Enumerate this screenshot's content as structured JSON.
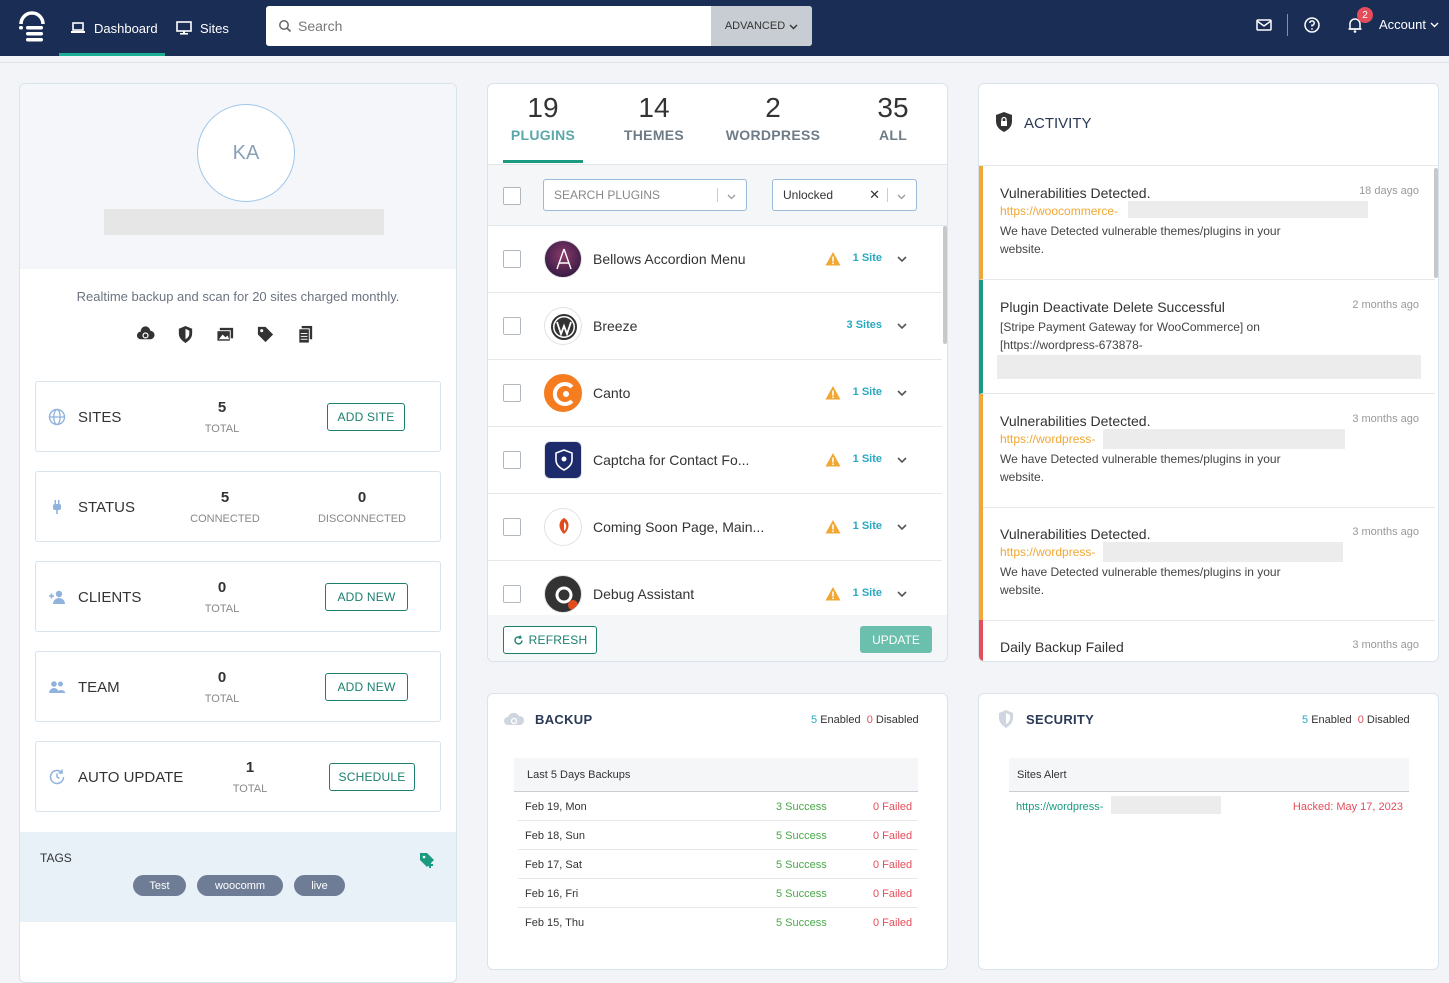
{
  "nav": {
    "tabs": [
      {
        "label": "Dashboard"
      },
      {
        "label": "Sites"
      }
    ],
    "search_placeholder": "Search",
    "advanced": "ADVANCED",
    "notifications": "2",
    "account": "Account"
  },
  "profile": {
    "initials": "KA",
    "plan": "Realtime backup and scan for 20 sites charged monthly."
  },
  "stats": {
    "sites": {
      "label": "SITES",
      "value": "5",
      "sub": "TOTAL",
      "action": "ADD SITE"
    },
    "status": {
      "label": "STATUS",
      "connected": "5",
      "connected_label": "CONNECTED",
      "disconnected": "0",
      "disconnected_label": "DISCONNECTED"
    },
    "clients": {
      "label": "CLIENTS",
      "value": "0",
      "sub": "TOTAL",
      "action": "ADD NEW"
    },
    "team": {
      "label": "TEAM",
      "value": "0",
      "sub": "TOTAL",
      "action": "ADD NEW"
    },
    "autoupdate": {
      "label": "AUTO UPDATE",
      "value": "1",
      "sub": "TOTAL",
      "action": "SCHEDULE"
    }
  },
  "tags": {
    "label": "TAGS",
    "items": [
      "Test",
      "woocomm",
      "live"
    ]
  },
  "plugins": {
    "tabs": [
      {
        "count": "19",
        "label": "PLUGINS"
      },
      {
        "count": "14",
        "label": "THEMES"
      },
      {
        "count": "2",
        "label": "WORDPRESS"
      },
      {
        "count": "35",
        "label": "ALL"
      }
    ],
    "search_placeholder": "SEARCH PLUGINS",
    "filter_value": "Unlocked",
    "rows": [
      {
        "name": "Bellows Accordion Menu",
        "sites": "1 Site",
        "warn": true
      },
      {
        "name": "Breeze",
        "sites": "3 Sites",
        "warn": false
      },
      {
        "name": "Canto",
        "sites": "1 Site",
        "warn": true
      },
      {
        "name": "Captcha for Contact Fo...",
        "sites": "1 Site",
        "warn": true
      },
      {
        "name": "Coming Soon Page, Main...",
        "sites": "1 Site",
        "warn": true
      },
      {
        "name": "Debug Assistant",
        "sites": "1 Site",
        "warn": true
      }
    ],
    "refresh": "REFRESH",
    "update": "UPDATE"
  },
  "activity": {
    "title": "ACTIVITY",
    "items": [
      {
        "title": "Vulnerabilities Detected.",
        "date": "18 days ago",
        "link": "https://woocommerce-",
        "body": "We have Detected vulnerable themes/plugins in your website.",
        "color": "#f0a733"
      },
      {
        "title": "Plugin Deactivate Delete Successful",
        "date": "2 months ago",
        "link": "",
        "body": "[Stripe Payment Gateway for WooCommerce] on [https://wordpress-673878-",
        "color": "#1b9a82"
      },
      {
        "title": "Vulnerabilities Detected.",
        "date": "3 months ago",
        "link": "https://wordpress-",
        "body": "We have Detected vulnerable themes/plugins in your website.",
        "color": "#f0a733"
      },
      {
        "title": "Vulnerabilities Detected.",
        "date": "3 months ago",
        "link": "https://wordpress-",
        "body": "We have Detected vulnerable themes/plugins in your website.",
        "color": "#f0a733"
      },
      {
        "title": "Daily Backup Failed",
        "date": "3 months ago",
        "link": "",
        "body": "",
        "color": "#e44d5b"
      }
    ]
  },
  "backup": {
    "title": "BACKUP",
    "enabled": "5",
    "enabled_label": "Enabled",
    "disabled": "0",
    "disabled_label": "Disabled",
    "table_title": "Last 5 Days Backups",
    "rows": [
      {
        "date": "Feb 19, Mon",
        "success": "3 Success",
        "failed": "0 Failed"
      },
      {
        "date": "Feb 18, Sun",
        "success": "5 Success",
        "failed": "0 Failed"
      },
      {
        "date": "Feb 17, Sat",
        "success": "5 Success",
        "failed": "0 Failed"
      },
      {
        "date": "Feb 16, Fri",
        "success": "5 Success",
        "failed": "0 Failed"
      },
      {
        "date": "Feb 15, Thu",
        "success": "5 Success",
        "failed": "0 Failed"
      }
    ]
  },
  "security": {
    "title": "SECURITY",
    "enabled": "5",
    "enabled_label": "Enabled",
    "disabled": "0",
    "disabled_label": "Disabled",
    "table_title": "Sites Alert",
    "alert": {
      "link": "https://wordpress-",
      "status": "Hacked: May 17, 2023"
    }
  },
  "colors": {
    "navbar": "#1a2d55",
    "accent": "#1b9a82",
    "warning": "#f0a733",
    "danger": "#e44d5b",
    "info": "#29a8c2"
  }
}
